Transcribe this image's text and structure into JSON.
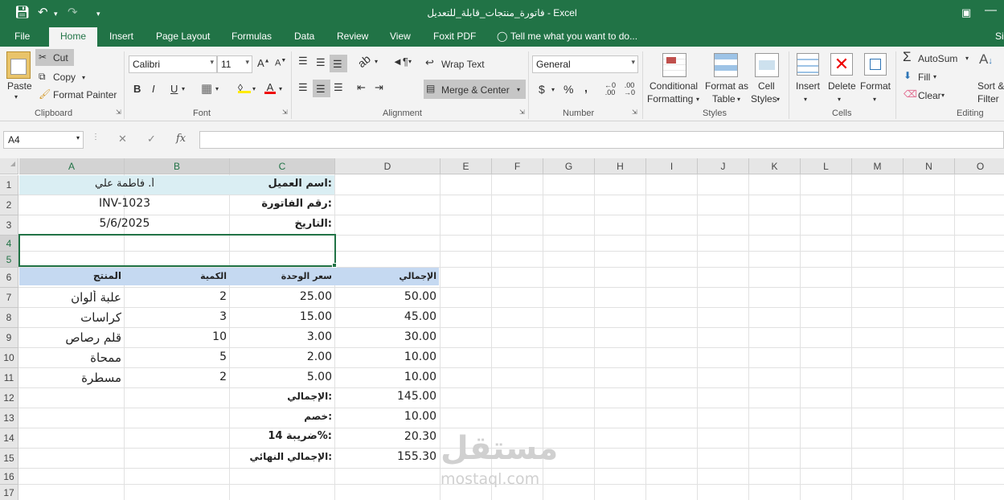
{
  "window": {
    "title": "فاتورة_منتجات_قابلة_للتعديل - Excel"
  },
  "quick_access": {
    "save_icon": "save-icon",
    "undo_icon": "undo-icon",
    "redo_icon": "redo-icon",
    "customize_icon": "chevron-down-icon",
    "ribbon_display_icon": "ribbon-display-icon"
  },
  "tabs": [
    "File",
    "Home",
    "Insert",
    "Page Layout",
    "Formulas",
    "Data",
    "Review",
    "View",
    "Foxit PDF"
  ],
  "tell_me": "Tell me what you want to do...",
  "signin": "Si",
  "ribbon": {
    "clipboard": {
      "paste": "Paste",
      "cut": "Cut",
      "copy": "Copy",
      "format_painter": "Format Painter",
      "label": "Clipboard"
    },
    "font": {
      "name": "Calibri",
      "size": "11",
      "label": "Font",
      "bold": "B",
      "italic": "I",
      "underline": "U"
    },
    "alignment": {
      "wrap": "Wrap Text",
      "merge": "Merge & Center",
      "label": "Alignment"
    },
    "number": {
      "format": "General",
      "currency": "$",
      "percent": "%",
      "comma": ",",
      "label": "Number"
    },
    "styles": {
      "conditional": "Conditional",
      "conditional2": "Formatting",
      "format_as": "Format as",
      "format_as2": "Table",
      "cell": "Cell",
      "cell2": "Styles",
      "label": "Styles"
    },
    "cells": {
      "insert": "Insert",
      "delete": "Delete",
      "format": "Format",
      "label": "Cells"
    },
    "editing": {
      "autosum": "AutoSum",
      "fill": "Fill",
      "clear": "Clear",
      "sort": "Sort &",
      "filter": "Filter",
      "label": "Editing"
    }
  },
  "formula_bar": {
    "name_box": "A4",
    "value": ""
  },
  "columns": [
    "A",
    "B",
    "C",
    "D",
    "E",
    "F",
    "G",
    "H",
    "I",
    "J",
    "K",
    "L",
    "M",
    "N",
    "O"
  ],
  "rows": [
    "1",
    "2",
    "3",
    "4",
    "5",
    "6",
    "7",
    "8",
    "9",
    "10",
    "11",
    "12",
    "13",
    "14",
    "15",
    "16",
    "17"
  ],
  "sheet": {
    "customer_label": "اسم العميل:",
    "customer_value": "أ. فاطمة علي",
    "invoice_label": "رقم الفاتورة:",
    "invoice_value": "INV-1023",
    "date_label": "التاريخ:",
    "date_value": "5/6/2025",
    "headers": {
      "product": "المنتج",
      "qty": "الكمية",
      "unit_price": "سعر الوحدة",
      "total": "الإجمالي"
    },
    "items": [
      {
        "product": "علبة ألوان",
        "qty": "2",
        "price": "25.00",
        "total": "50.00"
      },
      {
        "product": "كراسات",
        "qty": "3",
        "price": "15.00",
        "total": "45.00"
      },
      {
        "product": "قلم رصاص",
        "qty": "10",
        "price": "3.00",
        "total": "30.00"
      },
      {
        "product": "ممحاة",
        "qty": "5",
        "price": "2.00",
        "total": "10.00"
      },
      {
        "product": "مسطرة",
        "qty": "2",
        "price": "5.00",
        "total": "10.00"
      }
    ],
    "subtotal_label": "الإجمالي:",
    "subtotal": "145.00",
    "discount_label": "خصم:",
    "discount": "10.00",
    "tax_label": "ضريبة 14%:",
    "tax": "20.30",
    "grand_label": "الإجمالي النهائي:",
    "grand": "155.30"
  },
  "watermark": {
    "arabic": "مستقل",
    "latin": "mostaql.com"
  }
}
